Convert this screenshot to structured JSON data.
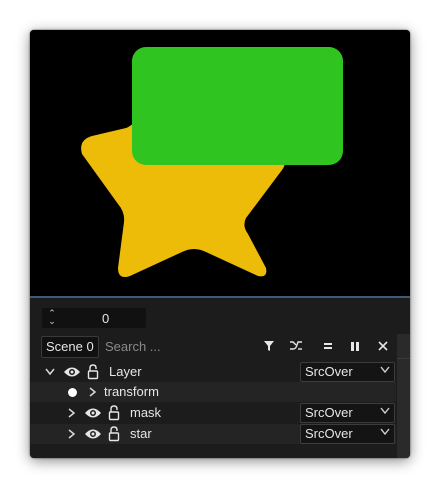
{
  "canvas": {
    "background": "#000000",
    "star_color": "#ecbc09",
    "rect_color": "#2fc41f"
  },
  "timeline": {
    "frame_value": "0"
  },
  "toolbar": {
    "scene_label": "Scene 0",
    "search_placeholder": "Search ...",
    "icons": [
      "filter-icon",
      "blend-curve-icon",
      "equals-icon",
      "pause-icon",
      "close-icon"
    ]
  },
  "layers": [
    {
      "label": "Layer",
      "expanded": true,
      "blend": "SrcOver"
    },
    {
      "label": "transform",
      "expanded": false
    },
    {
      "label": "mask",
      "expanded": false,
      "blend": "SrcOver"
    },
    {
      "label": "star",
      "expanded": false,
      "blend": "SrcOver"
    }
  ],
  "colors": {
    "panel_bg": "#1c1c1c",
    "divider": "#3d5a78",
    "text": "#e6e6e6"
  }
}
